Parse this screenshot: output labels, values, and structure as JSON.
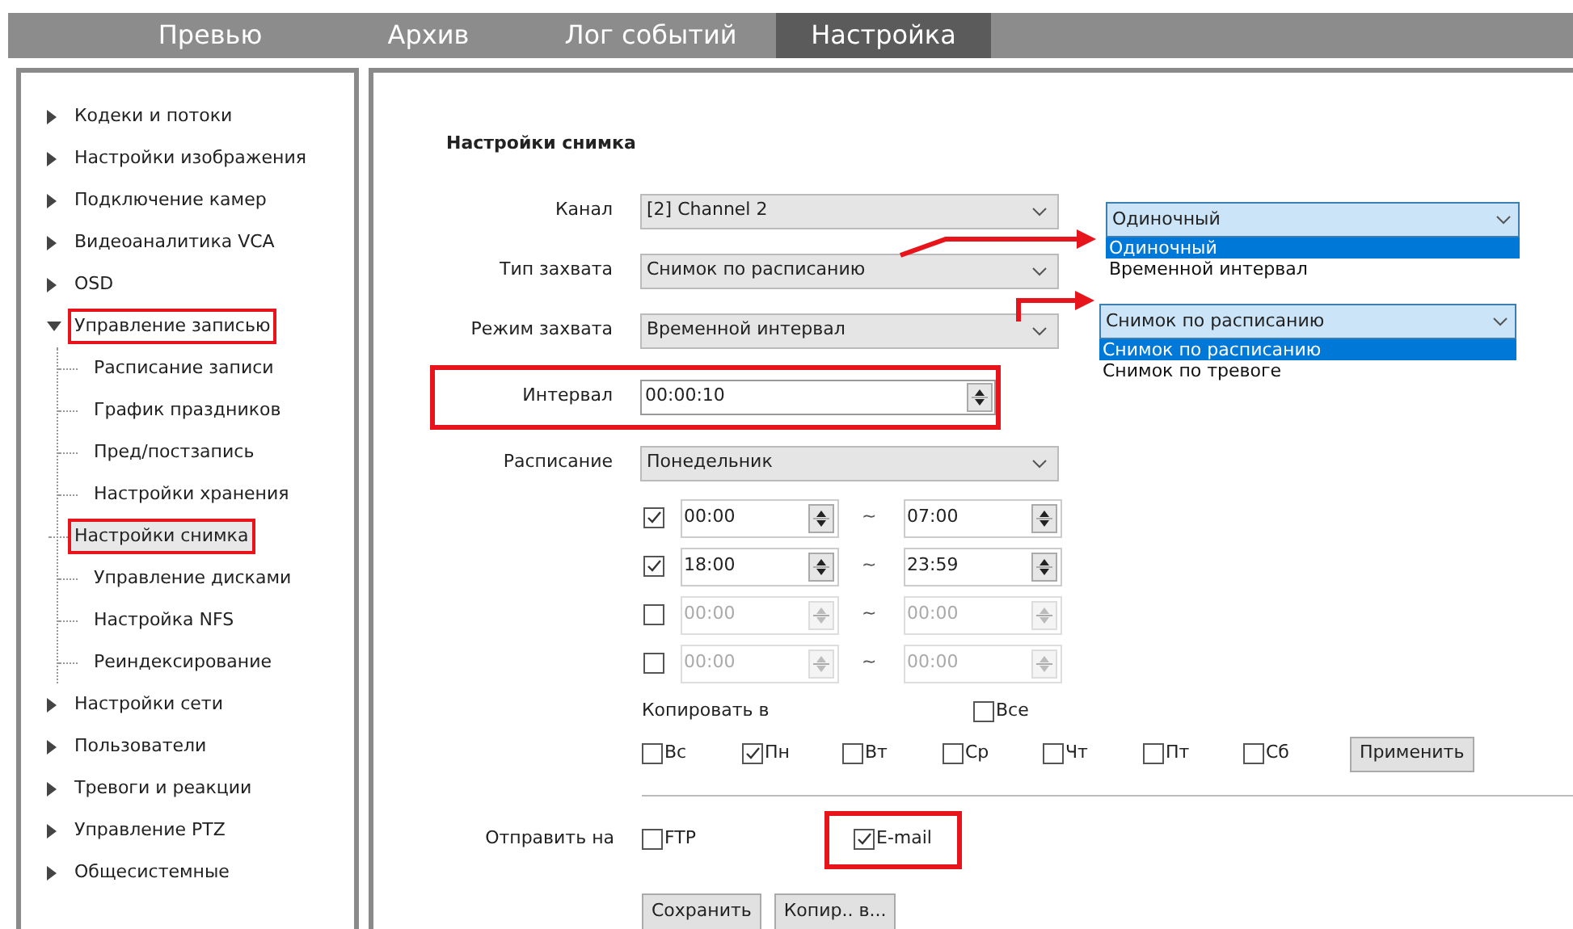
{
  "tabs": [
    {
      "label": "Превью",
      "selected": false
    },
    {
      "label": "Архив",
      "selected": false
    },
    {
      "label": "Лог событий",
      "selected": false
    },
    {
      "label": "Настройка",
      "selected": true
    }
  ],
  "sidebar": {
    "items": [
      {
        "label": "Кодеки и потоки",
        "expanded": false,
        "selected": false,
        "highlighted": false
      },
      {
        "label": "Настройки изображения",
        "expanded": false,
        "selected": false,
        "highlighted": false
      },
      {
        "label": "Подключение камер",
        "expanded": false,
        "selected": false,
        "highlighted": false
      },
      {
        "label": "Видеоаналитика VCA",
        "expanded": false,
        "selected": false,
        "highlighted": false
      },
      {
        "label": "OSD",
        "expanded": false,
        "selected": false,
        "highlighted": false
      },
      {
        "label": "Управление записью",
        "expanded": true,
        "selected": false,
        "highlighted": true,
        "children": [
          {
            "label": "Расписание записи",
            "selected": false,
            "highlighted": false
          },
          {
            "label": "График праздников",
            "selected": false,
            "highlighted": false
          },
          {
            "label": "Пред/постзапись",
            "selected": false,
            "highlighted": false
          },
          {
            "label": "Настройки хранения",
            "selected": false,
            "highlighted": false
          },
          {
            "label": "Настройки снимка",
            "selected": true,
            "highlighted": true
          },
          {
            "label": "Управление дисками",
            "selected": false,
            "highlighted": false
          },
          {
            "label": "Настройка NFS",
            "selected": false,
            "highlighted": false
          },
          {
            "label": "Реиндексирование",
            "selected": false,
            "highlighted": false
          }
        ]
      },
      {
        "label": "Настройки сети",
        "expanded": false,
        "selected": false,
        "highlighted": false
      },
      {
        "label": "Пользователи",
        "expanded": false,
        "selected": false,
        "highlighted": false
      },
      {
        "label": "Тревоги и реакции",
        "expanded": false,
        "selected": false,
        "highlighted": false
      },
      {
        "label": "Управление PTZ",
        "expanded": false,
        "selected": false,
        "highlighted": false
      },
      {
        "label": "Общесистемные",
        "expanded": false,
        "selected": false,
        "highlighted": false
      }
    ]
  },
  "form": {
    "title": "Настройки снимка",
    "fields": [
      {
        "label": "Канал",
        "kind": "select",
        "value": "[2] Channel 2",
        "highlighted": false
      },
      {
        "label": "Тип захвата",
        "kind": "select",
        "value": "Снимок по расписанию",
        "highlighted": false
      },
      {
        "label": "Режим захвата",
        "kind": "select",
        "value": "Временной интервал",
        "highlighted": false
      },
      {
        "label": "Интервал",
        "kind": "spin",
        "value": "00:00:10",
        "highlighted": true
      },
      {
        "label": "Расписание",
        "kind": "select",
        "value": "Понедельник",
        "highlighted": false
      }
    ],
    "periods": [
      {
        "checked": true,
        "start": "00:00",
        "separator": "~",
        "end": "07:00"
      },
      {
        "checked": true,
        "start": "18:00",
        "separator": "~",
        "end": "23:59"
      },
      {
        "checked": false,
        "start": "00:00",
        "separator": "~",
        "end": "00:00"
      },
      {
        "checked": false,
        "start": "00:00",
        "separator": "~",
        "end": "00:00"
      }
    ],
    "copy_to": {
      "label": "Копировать в",
      "all": {
        "label": "Все",
        "checked": false
      },
      "days": [
        {
          "label": "Вс",
          "checked": false
        },
        {
          "label": "Пн",
          "checked": true
        },
        {
          "label": "Вт",
          "checked": false
        },
        {
          "label": "Ср",
          "checked": false
        },
        {
          "label": "Чт",
          "checked": false
        },
        {
          "label": "Пт",
          "checked": false
        },
        {
          "label": "Сб",
          "checked": false
        }
      ],
      "apply_button": "Применить"
    },
    "send_to": {
      "label": "Отправить на",
      "options": [
        {
          "label": "FTP",
          "checked": false,
          "highlighted": false
        },
        {
          "label": "E-mail",
          "checked": true,
          "highlighted": true
        }
      ]
    },
    "buttons": [
      "Сохранить",
      "Копир.. в..."
    ]
  },
  "callouts": [
    {
      "value": "Одиночный",
      "options": [
        {
          "label": "Одиночный",
          "selected": true
        },
        {
          "label": "Временной интервал",
          "selected": false
        }
      ]
    },
    {
      "value": "Снимок по расписанию",
      "options": [
        {
          "label": "Снимок по расписанию",
          "selected": true
        },
        {
          "label": "Снимок по тревоге",
          "selected": false
        }
      ]
    }
  ]
}
